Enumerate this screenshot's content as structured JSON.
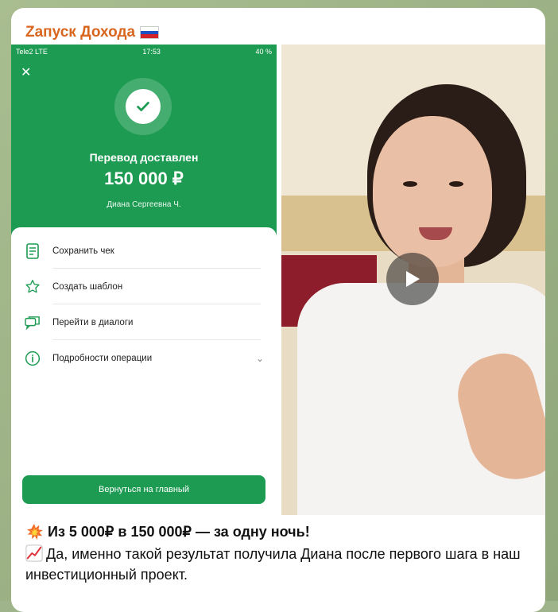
{
  "channel": {
    "title": "Zапуск Дохода",
    "flag_icon": "russia-flag-icon"
  },
  "phone": {
    "status": {
      "carrier": "Tele2 LTE",
      "time": "17:53",
      "battery": "40 %"
    },
    "transfer_title": "Перевод доставлен",
    "amount": "150 000 ₽",
    "recipient": "Диана Сергеевна Ч.",
    "actions": [
      {
        "label": "Сохранить чек",
        "icon": "receipt-icon"
      },
      {
        "label": "Создать шаблон",
        "icon": "star-badge-icon"
      },
      {
        "label": "Перейти в диалоги",
        "icon": "chat-icon"
      },
      {
        "label": "Подробности операции",
        "icon": "info-icon"
      }
    ],
    "home_button": "Вернуться на главный",
    "accent": "#1e9b52"
  },
  "video": {
    "play_icon": "play-icon"
  },
  "caption": {
    "line1": "Из 5 000₽ в 150 000₽ — за одну ночь!",
    "line2": "Да, именно такой результат получила Диана после первого шага в наш инвестиционный проект."
  },
  "colors": {
    "title": "#d9661f",
    "background": "#9fb48a"
  }
}
